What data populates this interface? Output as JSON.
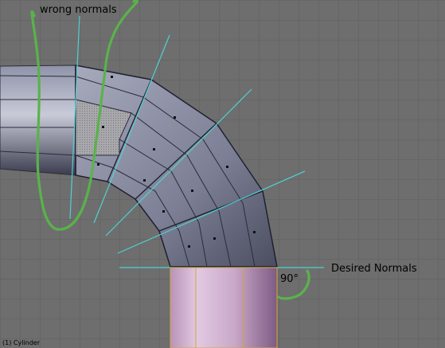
{
  "annotations": {
    "wrong_normals": "wrong normals",
    "desired_normals": "Desired Normals",
    "angle": "90°"
  },
  "viewport": {
    "object_name": "(1) Cylinder",
    "background_color": "#6e6e6e",
    "grid_color": "#5f5f5f",
    "normal_color": "#4fd1d1",
    "marker_color": "#59b34a",
    "mesh_color": "#8f93a8",
    "selected_face_color": "#b8b8b8",
    "cylinder_color": "#c9a8c9"
  }
}
